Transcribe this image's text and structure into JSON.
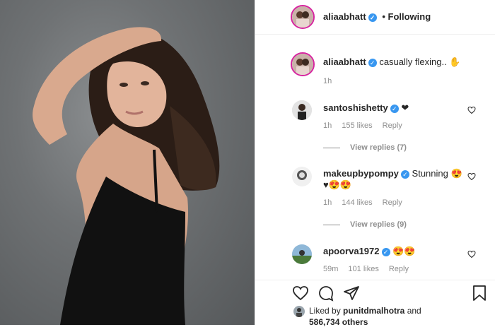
{
  "post_author": {
    "username": "aliaabhatt",
    "follow_status": "Following"
  },
  "caption": {
    "username": "aliaabhatt",
    "text": "casually flexing.. ",
    "emoji": "✋",
    "time": "1h"
  },
  "comments": [
    {
      "username": "santoshishetty",
      "text": "",
      "emoji": "❤",
      "time": "1h",
      "likes": "155 likes",
      "reply": "Reply",
      "view_replies": "View replies (7)"
    },
    {
      "username": "makeupbypompy",
      "text": "Stunning ",
      "emoji": "😍",
      "second_line": "♥😍😍",
      "time": "1h",
      "likes": "144 likes",
      "reply": "Reply",
      "view_replies": "View replies (9)"
    },
    {
      "username": "apoorva1972",
      "text": "",
      "emoji": "😍😍",
      "time": "59m",
      "likes": "101 likes",
      "reply": "Reply"
    }
  ],
  "likes": {
    "prefix": "Liked by ",
    "user": "punitdmalhotra",
    "and": " and",
    "others": "586,734 others"
  },
  "colors": {
    "verified": "#3897f0",
    "story_ring": "#d6249f",
    "follow_text": "#262626"
  },
  "icons": {
    "like": "heart-icon",
    "comment": "comment-icon",
    "share": "send-icon",
    "save": "bookmark-icon"
  }
}
